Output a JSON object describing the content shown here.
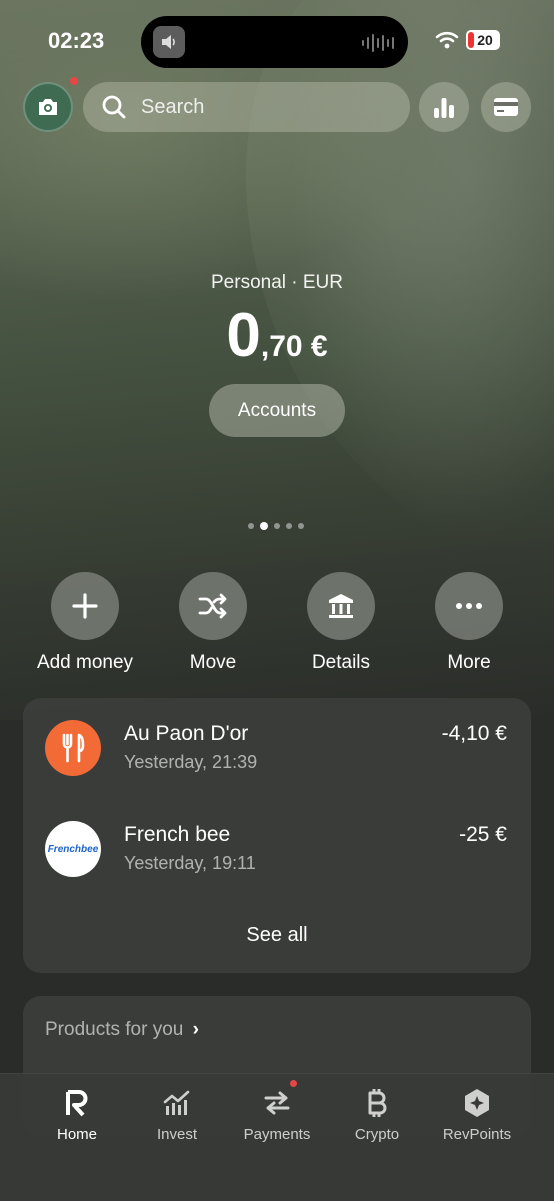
{
  "status_bar": {
    "time": "02:23",
    "battery": "20"
  },
  "header": {
    "search_placeholder": "Search"
  },
  "balance": {
    "account_label": "Personal · EUR",
    "integer_part": "0",
    "decimal_part": ",70 €",
    "accounts_button": "Accounts"
  },
  "pager": {
    "count": 5,
    "active_index": 1
  },
  "actions": [
    {
      "label": "Add money",
      "icon": "plus-icon"
    },
    {
      "label": "Move",
      "icon": "shuffle-icon"
    },
    {
      "label": "Details",
      "icon": "bank-icon"
    },
    {
      "label": "More",
      "icon": "more-icon"
    }
  ],
  "transactions": [
    {
      "name": "Au Paon D'or",
      "time": "Yesterday, 21:39",
      "amount": "-4,10 €",
      "logo": "fork-knife-icon",
      "logo_color": "#f26b36"
    },
    {
      "name": "French bee",
      "time": "Yesterday, 19:11",
      "amount": "-25 €",
      "logo": "frenchbee-logo",
      "logo_text": "Frenchbee",
      "logo_color": "#ffffff"
    }
  ],
  "see_all": "See all",
  "products": {
    "title": "Products for you",
    "chevron": "›"
  },
  "nav": [
    {
      "label": "Home",
      "icon": "revolut-r-icon",
      "active": true
    },
    {
      "label": "Invest",
      "icon": "chart-icon",
      "active": false
    },
    {
      "label": "Payments",
      "icon": "transfer-arrows-icon",
      "active": false,
      "badge": true
    },
    {
      "label": "Crypto",
      "icon": "bitcoin-icon",
      "active": false
    },
    {
      "label": "RevPoints",
      "icon": "hexagon-star-icon",
      "active": false
    }
  ],
  "colors": {
    "accent_red": "#e64646",
    "restaurant_orange": "#f26b36",
    "avatar_green": "#3f6b52"
  }
}
